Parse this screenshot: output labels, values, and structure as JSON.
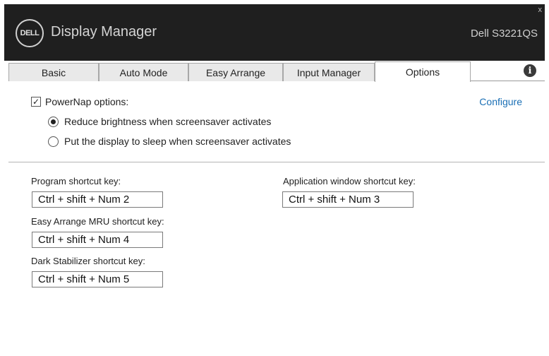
{
  "window": {
    "logo_text": "DELL",
    "title": "Display Manager",
    "model": "Dell S3221QS",
    "close_glyph": "x"
  },
  "tabs": [
    {
      "label": "Basic"
    },
    {
      "label": "Auto Mode"
    },
    {
      "label": "Easy Arrange"
    },
    {
      "label": "Input Manager"
    },
    {
      "label": "Options",
      "active": true
    }
  ],
  "info_icon": "i",
  "powernap": {
    "checked": true,
    "label": "PowerNap options:",
    "configure_label": "Configure",
    "options": [
      {
        "label": "Reduce brightness when screensaver activates",
        "selected": true
      },
      {
        "label": "Put the display to sleep when screensaver activates",
        "selected": false
      }
    ]
  },
  "shortcuts": {
    "program": {
      "label": "Program shortcut key:",
      "value": "Ctrl + shift + Num 2"
    },
    "application_window": {
      "label": "Application window shortcut key:",
      "value": "Ctrl + shift + Num 3"
    },
    "easy_arrange_mru": {
      "label": "Easy Arrange MRU shortcut key:",
      "value": "Ctrl + shift + Num 4"
    },
    "dark_stabilizer": {
      "label": "Dark Stabilizer shortcut key:",
      "value": "Ctrl + shift + Num 5"
    }
  },
  "colors": {
    "titlebar": "#1f1f1f",
    "link": "#1a6fb5"
  }
}
